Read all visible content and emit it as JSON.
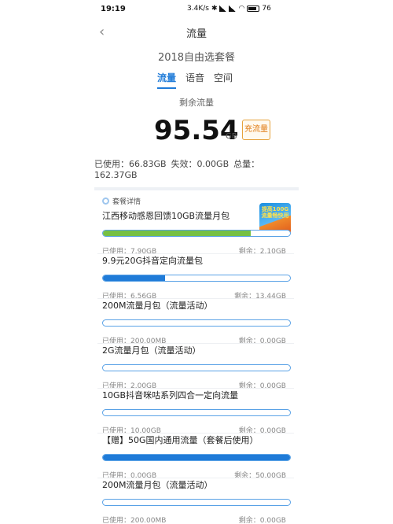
{
  "status": {
    "time": "19:19",
    "speed": "3.4K/s",
    "battery": "76"
  },
  "nav": {
    "back_icon": "chevron-left-icon",
    "title": "流量"
  },
  "plan_name": "2018自由选套餐",
  "tabs": [
    {
      "label": "流量",
      "active": true
    },
    {
      "label": "语音",
      "active": false
    },
    {
      "label": "空间",
      "active": false
    }
  ],
  "remaining": {
    "label": "剩余流量",
    "value": "95.54",
    "unit": "GB",
    "recharge_button": "充流量"
  },
  "summary": {
    "used": "已使用：66.83GB",
    "expired": "失效：0.00GB",
    "total": "总量：162.37GB"
  },
  "detail": {
    "title": "套餐详情",
    "badge": "提高100G 流量畅快用"
  },
  "packages": [
    {
      "name": "江西移动感恩回馈10GB流量月包",
      "used": "已使用：7.90GB",
      "left": "剩余：2.10GB",
      "used_fraction": 0.79,
      "color": "#76c043"
    },
    {
      "name": "9.9元20G抖音定向流量包",
      "used": "已使用：6.56GB",
      "left": "剩余：13.44GB",
      "used_fraction": 0.33,
      "color": "#1f7bd8"
    },
    {
      "name": "200M流量月包（流量活动）",
      "used": "已使用：200.00MB",
      "left": "剩余：0.00GB",
      "used_fraction": 0.0,
      "color": "#1f7bd8"
    },
    {
      "name": "2G流量月包（流量活动）",
      "used": "已使用：2.00GB",
      "left": "剩余：0.00GB",
      "used_fraction": 0.0,
      "color": "#1f7bd8"
    },
    {
      "name": "10GB抖音咪咕系列四合一定向流量",
      "used": "已使用：10.00GB",
      "left": "剩余：0.00GB",
      "used_fraction": 0.0,
      "color": "#1f7bd8"
    },
    {
      "name": "【赠】50G国内通用流量（套餐后使用）",
      "used": "已使用：0.00GB",
      "left": "剩余：50.00GB",
      "used_fraction": 1.0,
      "color": "#1f7bd8"
    },
    {
      "name": "200M流量月包（流量活动）",
      "used": "已使用：200.00MB",
      "left": "剩余：0.00GB",
      "used_fraction": 0.0,
      "color": "#1f7bd8"
    }
  ]
}
